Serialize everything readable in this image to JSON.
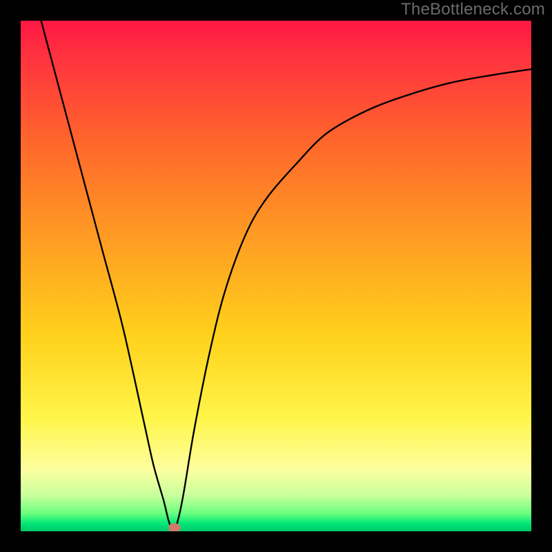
{
  "watermark": "TheBottleneck.com",
  "chart_data": {
    "type": "line",
    "title": "",
    "xlabel": "",
    "ylabel": "",
    "xlim": [
      0,
      100
    ],
    "ylim": [
      0,
      100
    ],
    "grid": false,
    "legend": false,
    "background_gradient_stops": [
      {
        "offset": 0,
        "color": "#ff1744"
      },
      {
        "offset": 0.06,
        "color": "#ff2f40"
      },
      {
        "offset": 0.25,
        "color": "#ff6a2a"
      },
      {
        "offset": 0.45,
        "color": "#ffa322"
      },
      {
        "offset": 0.62,
        "color": "#ffd21c"
      },
      {
        "offset": 0.78,
        "color": "#fff54a"
      },
      {
        "offset": 0.88,
        "color": "#fdffa0"
      },
      {
        "offset": 0.93,
        "color": "#c8ff9d"
      },
      {
        "offset": 0.965,
        "color": "#6aff7e"
      },
      {
        "offset": 0.985,
        "color": "#00e676"
      },
      {
        "offset": 1.0,
        "color": "#00c86a"
      }
    ],
    "series": [
      {
        "name": "bottleneck-curve",
        "x": [
          4,
          8,
          12,
          16,
          20,
          24,
          26,
          28,
          29,
          30,
          31,
          32,
          34,
          37,
          40,
          44,
          48,
          54,
          60,
          68,
          76,
          84,
          92,
          100
        ],
        "y": [
          100,
          85,
          70,
          55,
          40,
          22,
          13,
          6,
          2,
          0,
          3,
          8,
          20,
          35,
          47,
          58,
          65,
          72,
          78,
          82.5,
          85.5,
          87.8,
          89.3,
          90.5
        ],
        "color": "#000000",
        "linewidth": 2,
        "note": "y is bottleneck % (0 = bottom/green, 100 = top/red). Values read off the curve; minimum at x≈30."
      }
    ],
    "marker": {
      "x": 30.1,
      "y": 0.7,
      "rx": 1.2,
      "ry": 0.9,
      "color": "#d17a6b",
      "name": "optimal-point"
    }
  }
}
